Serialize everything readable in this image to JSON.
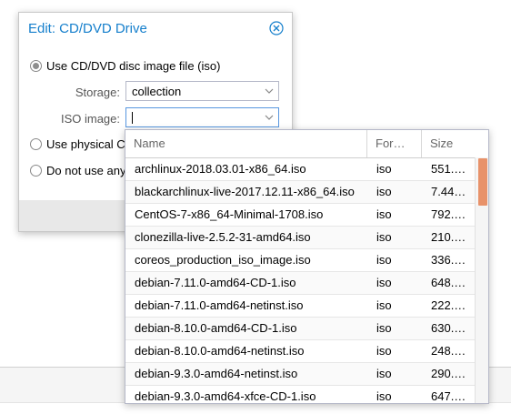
{
  "dialog": {
    "title": "Edit: CD/DVD Drive",
    "close_icon": "close-circle-icon",
    "options": {
      "iso": "Use CD/DVD disc image file (iso)",
      "physical": "Use physical C",
      "none": "Do not use any"
    },
    "storage": {
      "label": "Storage:",
      "value": "collection"
    },
    "iso_image": {
      "label": "ISO image:",
      "value": ""
    }
  },
  "picker": {
    "columns": {
      "name": "Name",
      "format": "For…",
      "size": "Size"
    },
    "rows": [
      {
        "name": "archlinux-2018.03.01-x86_64.iso",
        "format": "iso",
        "size": "551.…"
      },
      {
        "name": "blackarchlinux-live-2017.12.11-x86_64.iso",
        "format": "iso",
        "size": "7.44…"
      },
      {
        "name": "CentOS-7-x86_64-Minimal-1708.iso",
        "format": "iso",
        "size": "792.…"
      },
      {
        "name": "clonezilla-live-2.5.2-31-amd64.iso",
        "format": "iso",
        "size": "210.…"
      },
      {
        "name": "coreos_production_iso_image.iso",
        "format": "iso",
        "size": "336.…"
      },
      {
        "name": "debian-7.11.0-amd64-CD-1.iso",
        "format": "iso",
        "size": "648.…"
      },
      {
        "name": "debian-7.11.0-amd64-netinst.iso",
        "format": "iso",
        "size": "222.…"
      },
      {
        "name": "debian-8.10.0-amd64-CD-1.iso",
        "format": "iso",
        "size": "630.…"
      },
      {
        "name": "debian-8.10.0-amd64-netinst.iso",
        "format": "iso",
        "size": "248.…"
      },
      {
        "name": "debian-9.3.0-amd64-netinst.iso",
        "format": "iso",
        "size": "290.…"
      },
      {
        "name": "debian-9.3.0-amd64-xfce-CD-1.iso",
        "format": "iso",
        "size": "647.…"
      }
    ]
  },
  "colors": {
    "title": "#157fcc",
    "scroll_thumb": "#e8926a"
  }
}
